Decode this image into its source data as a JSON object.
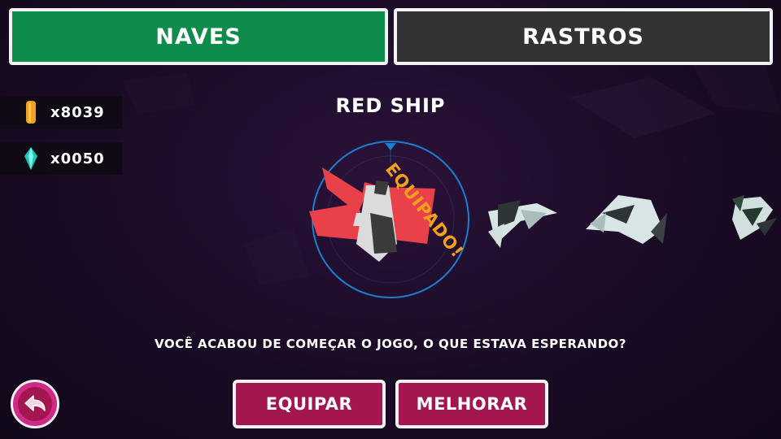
{
  "tabs": {
    "ships_label": "NAVES",
    "trails_label": "RASTROS"
  },
  "currency": {
    "coins": "x8039",
    "gems": "x0050"
  },
  "ship": {
    "name": "RED SHIP",
    "equipped_label": "EQUIPADO!"
  },
  "message": "VOCÊ ACABOU DE COMEÇAR O JOGO, O QUE ESTAVA ESPERANDO?",
  "buttons": {
    "equip_label": "EQUIPAR",
    "upgrade_label": "MELHORAR"
  },
  "colors": {
    "ships_tab": "#0d8c4c",
    "trails_tab": "#333333",
    "button": "#a3164f",
    "accent": "#f3a01f",
    "selector_ring": "#1a7fd0"
  },
  "icons": {
    "coin": "coin-icon",
    "gem": "gem-icon",
    "back": "back-arrow-icon"
  }
}
